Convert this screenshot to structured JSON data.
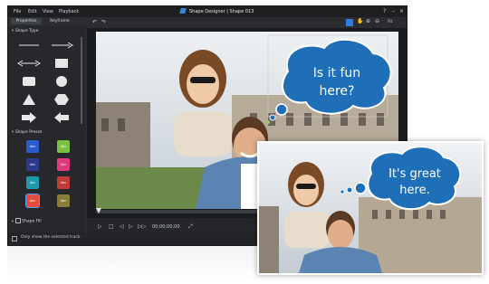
{
  "window": {
    "menu": [
      "File",
      "Edit",
      "View",
      "Playback"
    ],
    "title": "Shape Designer | Shape 013",
    "tabs": [
      "Properties",
      "Keyframe"
    ],
    "zoom": "Fit"
  },
  "left_panel": {
    "shape_type_title": "Shape Type",
    "shape_preset_title": "Shape Preset",
    "preset_labels": [
      "Abc",
      "Abc",
      "Abc",
      "Abc",
      "Abc",
      "Abc",
      "Abc",
      "Abc",
      "Abc",
      "Abc"
    ],
    "shape_fill_title": "Shape Fill"
  },
  "canvas": {
    "bubble_line1": "Is it fun",
    "bubble_line2": "here?"
  },
  "player": {
    "timecode": "00;00;00;00"
  },
  "status": {
    "checkbox_label": "Only show the selected track"
  },
  "second_image": {
    "bubble_line1": "It's great",
    "bubble_line2": "here."
  },
  "colors": {
    "bubble_blue": "#1f6fb8",
    "bubble_stroke": "#ffffff",
    "accent": "#2f7fe0"
  }
}
